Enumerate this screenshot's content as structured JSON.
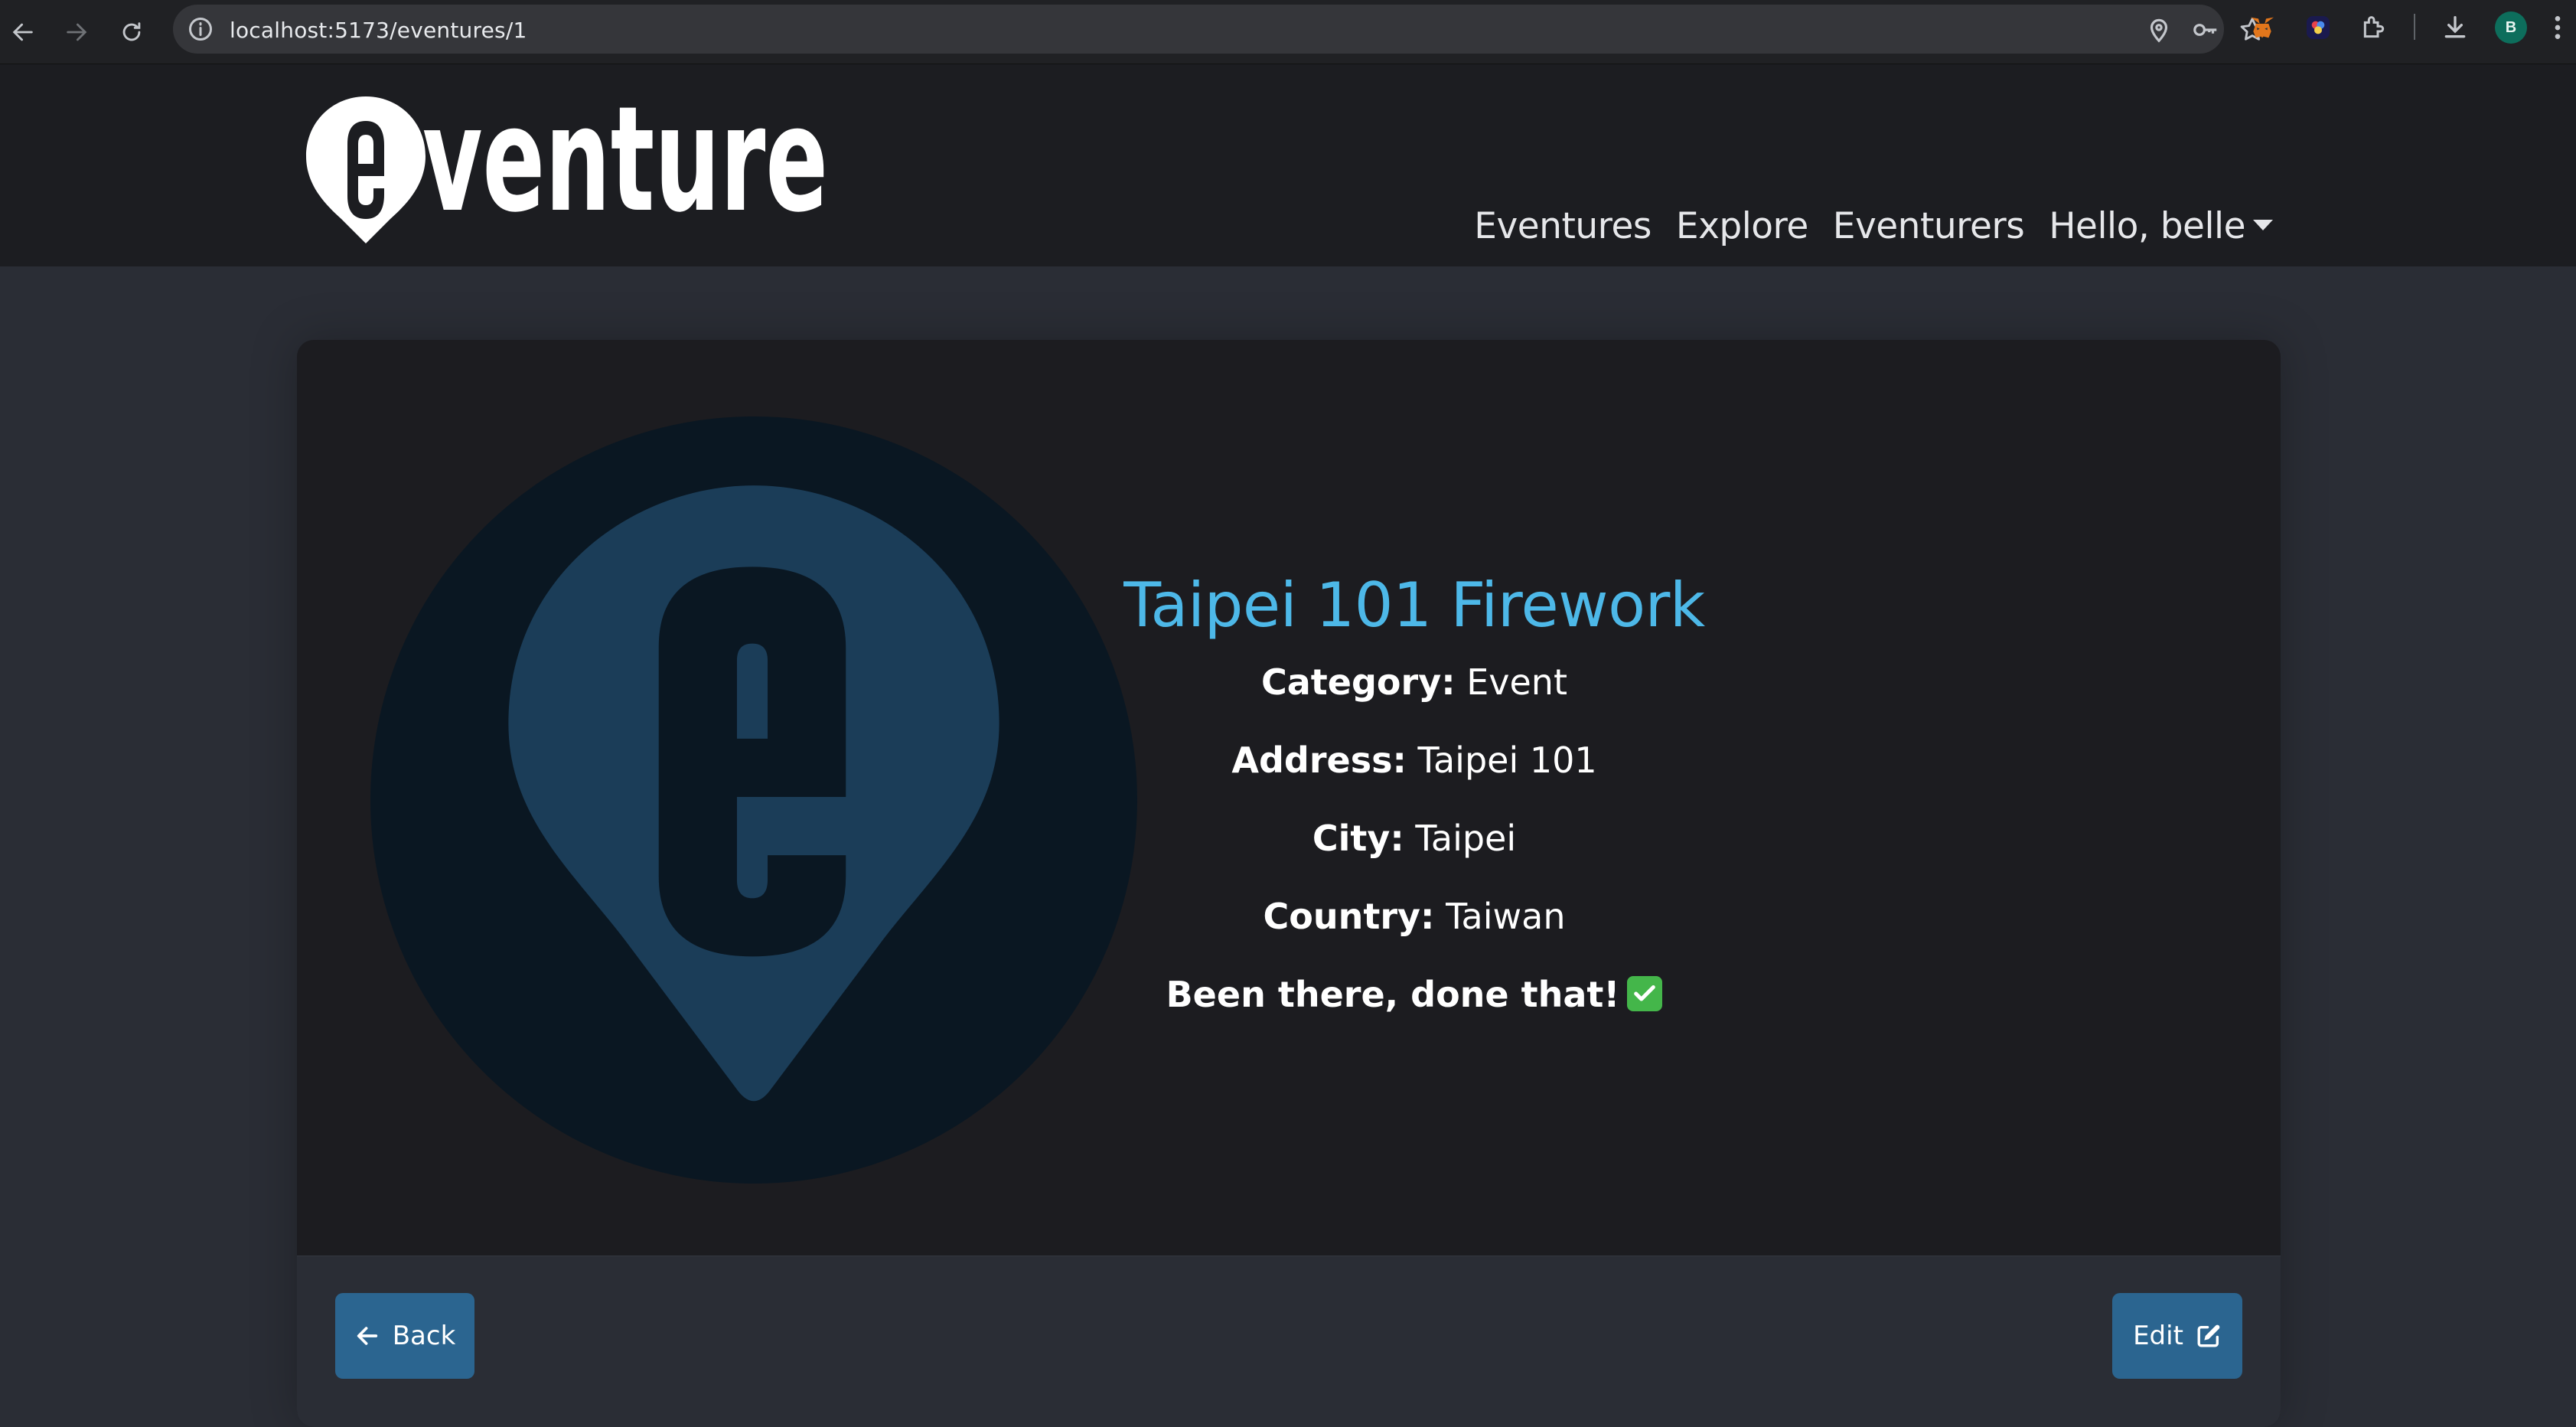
{
  "browser": {
    "url": "localhost:5173/eventures/1",
    "profile_initial": "B"
  },
  "navbar": {
    "brand": "eventure",
    "links": [
      "Eventures",
      "Explore",
      "Eventurers"
    ],
    "user_menu": "Hello, belle"
  },
  "eventure": {
    "title": "Taipei 101 Firework",
    "category_label": "Category:",
    "category": "Event",
    "address_label": "Address:",
    "address": "Taipei 101",
    "city_label": "City:",
    "city": "Taipei",
    "country_label": "Country:",
    "country": "Taiwan",
    "visited_text": "Been there, done that!"
  },
  "footer": {
    "back_label": "Back",
    "edit_label": "Edit"
  },
  "colors": {
    "page_bg": "#2a2d35",
    "navbar_bg": "#1c1d21",
    "card_bg": "#1c1c20",
    "title": "#4db8e8",
    "button": "#2b6590",
    "hero_circle": "#0a1722",
    "hero_pin": "#1b3d58"
  }
}
